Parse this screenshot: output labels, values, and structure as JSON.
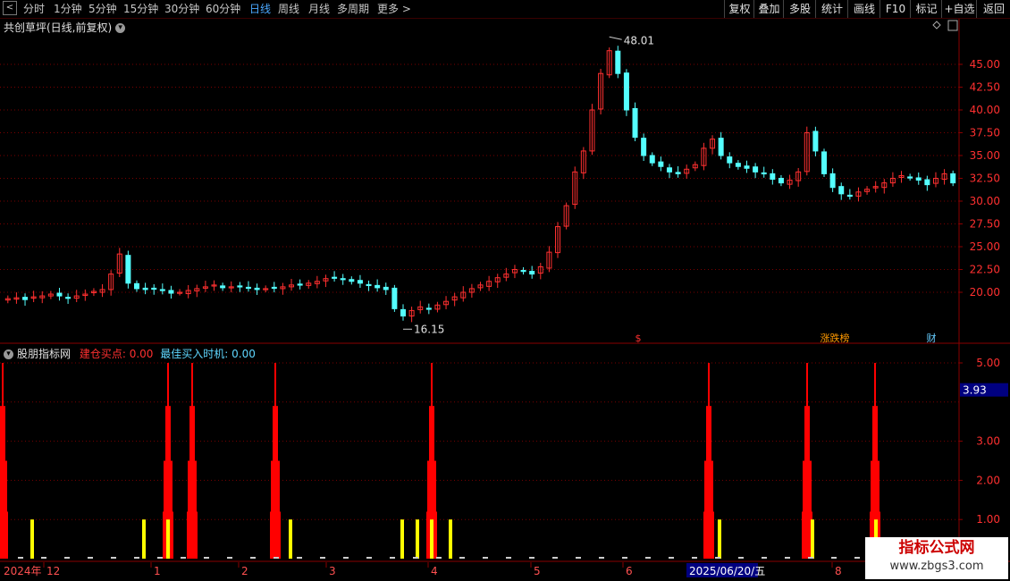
{
  "toolbar": {
    "back_icon": "back-arrow-icon",
    "periods": [
      "分时",
      "1分钟",
      "5分钟",
      "15分钟",
      "30分钟",
      "60分钟",
      "日线",
      "周线",
      "月线",
      "多周期",
      "更多 >"
    ],
    "active_period": "日线",
    "right_buttons": [
      "复权",
      "叠加",
      "多股",
      "统计",
      "画线",
      "F10",
      "标记",
      "+自选",
      "返回"
    ]
  },
  "main_chart": {
    "title": "共创草坪(日线,前复权)",
    "y_ticks": [
      "45.00",
      "42.50",
      "40.00",
      "37.50",
      "35.00",
      "32.50",
      "30.00",
      "27.50",
      "25.00",
      "22.50",
      "20.00"
    ],
    "high_label": "48.01",
    "low_label": "16.15",
    "markers": [
      "$",
      "涨跌榜",
      "财"
    ]
  },
  "indicator": {
    "name": "股朋指标网",
    "line1_label": "建仓买点:",
    "line1_value": "0.00",
    "line2_label": "最佳买入时机:",
    "line2_value": "0.00",
    "y_ticks": [
      "5.00",
      "3.00",
      "2.00",
      "1.00"
    ],
    "current_value": "3.93"
  },
  "x_axis": {
    "labels": [
      "2024年",
      "12",
      "1",
      "2",
      "3",
      "4",
      "5",
      "6",
      "2025/06/20/五",
      "8"
    ]
  },
  "watermark": {
    "line1": "指标公式网",
    "line2": "www.zbgs3.com"
  },
  "colors": {
    "up": "#ff3030",
    "down": "#54ffff",
    "accent_blue": "#4aa8ff",
    "grid": "#7a0000",
    "signal_yellow": "#ffff00",
    "signal_red": "#ff0000"
  },
  "chart_data": {
    "type": "candlestick",
    "price_scale_ticks": [
      45.0,
      42.5,
      40.0,
      37.5,
      35.0,
      32.5,
      30.0,
      27.5,
      25.0,
      22.5,
      20.0
    ],
    "ylim": [
      18.0,
      47.0
    ],
    "high": 48.01,
    "low": 16.15,
    "approx_close_series": [
      19.3,
      19.4,
      19.2,
      19.5,
      19.6,
      19.8,
      19.6,
      19.4,
      19.6,
      19.8,
      20.1,
      20.3,
      22.0,
      24.2,
      21.0,
      20.4,
      20.3,
      20.4,
      20.2,
      19.9,
      20.0,
      20.2,
      20.4,
      20.6,
      20.8,
      20.5,
      20.6,
      20.7,
      20.5,
      20.3,
      20.4,
      20.5,
      20.6,
      20.8,
      20.9,
      21.0,
      21.2,
      21.5,
      21.6,
      21.4,
      21.2,
      21.0,
      20.8,
      20.5,
      20.3,
      18.2,
      17.4,
      18.0,
      18.4,
      18.2,
      18.6,
      19.0,
      19.5,
      20.0,
      20.4,
      20.8,
      21.2,
      21.6,
      22.0,
      22.5,
      22.3,
      22.0,
      22.8,
      24.4,
      27.2,
      29.5,
      33.2,
      35.5,
      40.0,
      44.0,
      46.5,
      44.0,
      40.0,
      37.0,
      35.0,
      34.2,
      33.8,
      33.2,
      33.0,
      33.5,
      34.0,
      35.8,
      36.8,
      35.0,
      34.2,
      33.8,
      33.6,
      33.2,
      33.0,
      32.4,
      32.0,
      32.3,
      33.2,
      37.5,
      35.5,
      33.0,
      31.5,
      30.8,
      30.6,
      31.0,
      31.3,
      31.6,
      32.0,
      32.5,
      32.8,
      32.6,
      32.3,
      31.8,
      32.5,
      33.0,
      32.0
    ],
    "indicator_series": [
      {
        "name": "建仓买点",
        "value": 0.0
      },
      {
        "name": "最佳买入时机",
        "value": 0.0
      }
    ],
    "indicator_ylim": [
      0,
      5.3
    ],
    "red_spike_value": 5.0,
    "yellow_signal_value": 1.0
  }
}
